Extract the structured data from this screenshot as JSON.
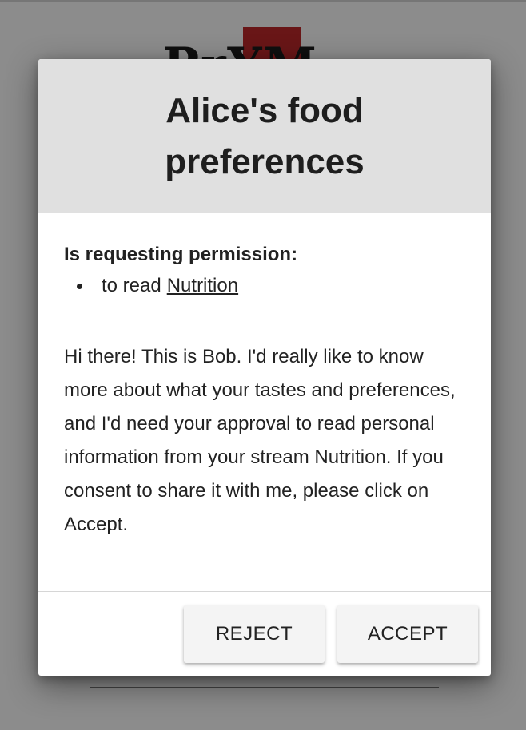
{
  "dialog": {
    "title": "Alice's food preferences",
    "permission_heading": "Is requesting permission:",
    "permissions": [
      {
        "prefix": "to read",
        "stream": "Nutrition"
      }
    ],
    "message": "Hi there! This is Bob. I'd really like to know more about what your tastes and preferences, and I'd need your approval to read personal information from your stream Nutrition. If you consent to share it with me, please click on Accept.",
    "reject_label": "REJECT",
    "accept_label": "ACCEPT"
  },
  "background_page": {
    "logo_color": "#c0282a"
  }
}
